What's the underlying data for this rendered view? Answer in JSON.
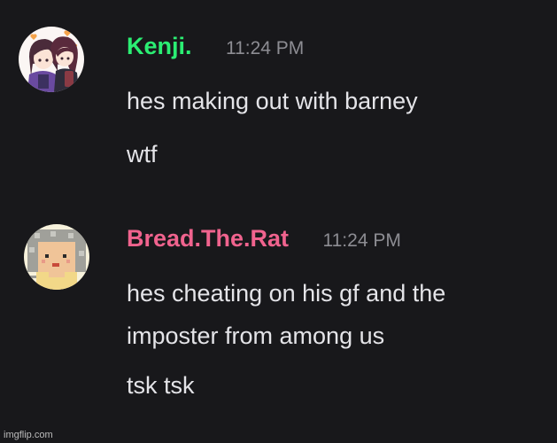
{
  "messages": [
    {
      "username": "Kenji.",
      "username_color": "#2bee73",
      "timestamp": "11:24 PM",
      "avatar_icon": "anime-couple-avatar",
      "lines": [
        "hes making out with barney",
        "wtf"
      ]
    },
    {
      "username": "Bread.The.Rat",
      "username_color": "#f0638e",
      "timestamp": "11:24 PM",
      "avatar_icon": "pixel-art-character-avatar",
      "lines": [
        "hes cheating on his gf and the",
        "imposter from among us",
        "tsk tsk"
      ]
    }
  ],
  "watermark": "imgflip.com",
  "colors": {
    "background": "#18181b",
    "message_text": "#e4e4e8",
    "timestamp_text": "#8d8d93"
  }
}
